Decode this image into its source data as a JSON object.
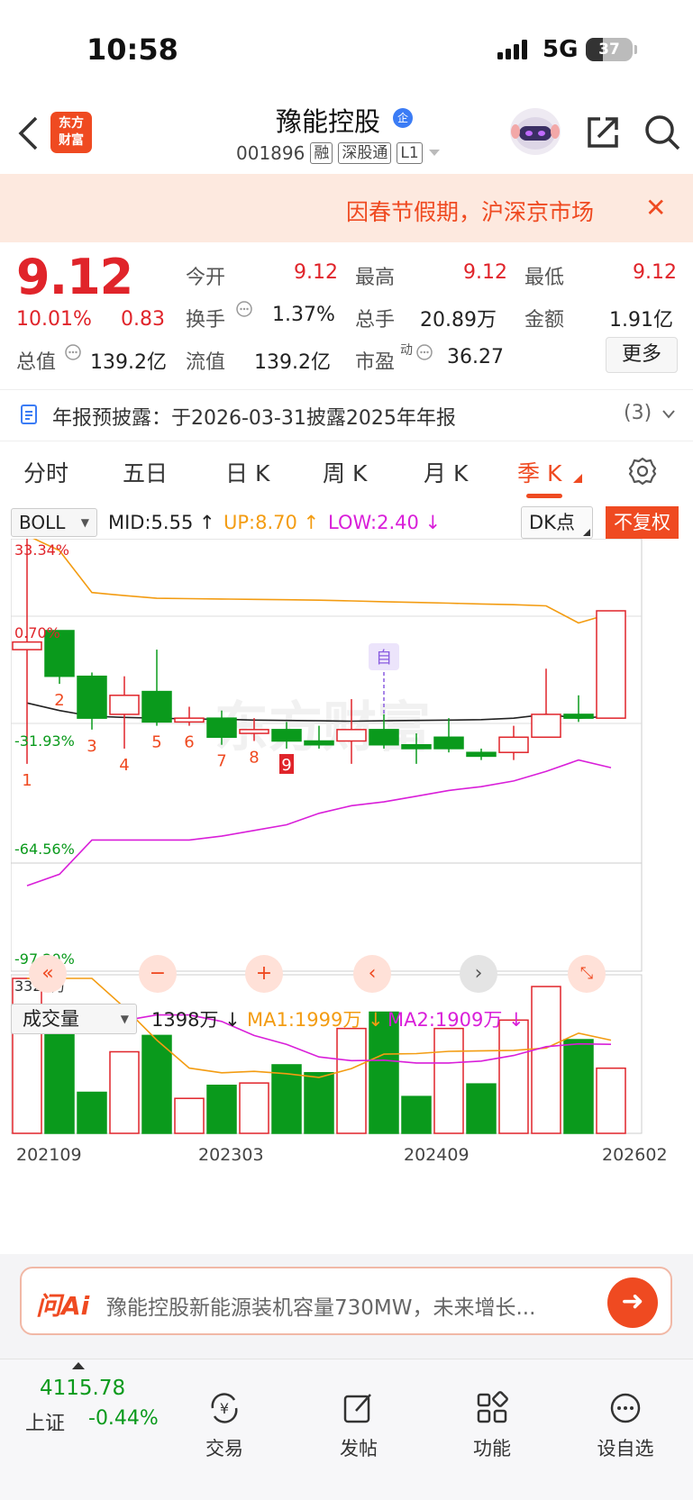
{
  "status_bar": {
    "time": "10:58",
    "network": "5G",
    "battery": "37"
  },
  "header": {
    "logo_line1": "东方",
    "logo_line2": "财富",
    "stock_name": "豫能控股",
    "badge": "企",
    "code": "001896",
    "tags": [
      "融",
      "深股通",
      "L1"
    ]
  },
  "banner": {
    "text": "因春节假期，沪深京市场"
  },
  "quote": {
    "price": "9.12",
    "change_pct": "10.01%",
    "change": "0.83",
    "labels": {
      "open": "今开",
      "high": "最高",
      "low": "最低",
      "turnover": "换手",
      "volume": "总手",
      "amount": "金额",
      "total_value": "总值",
      "float_value": "流值",
      "pe": "市盈",
      "pe_sup": "动",
      "more": "更多"
    },
    "values": {
      "open": "9.12",
      "high": "9.12",
      "low": "9.12",
      "turnover": "1.37%",
      "volume": "20.89万",
      "amount": "1.91亿",
      "total_value": "139.2亿",
      "float_value": "139.2亿",
      "pe": "36.27"
    }
  },
  "notice": {
    "text": "年报预披露：于2026-03-31披露2025年年报",
    "count": "(3)"
  },
  "tabs": [
    "分时",
    "五日",
    "日 K",
    "周 K",
    "月 K",
    "季 K"
  ],
  "indicator": {
    "select": "BOLL",
    "mid": "MID:5.55",
    "up": "UP:8.70",
    "low": "LOW:2.40",
    "dk": "DK点",
    "fq": "不复权"
  },
  "chart_data": {
    "type": "candlestick",
    "period": "季K",
    "axis_labels": [
      "33.34%",
      "0.70%",
      "-31.93%",
      "-64.56%",
      "-97.20%"
    ],
    "marker": "自",
    "annotations": [
      "1",
      "2",
      "3",
      "4",
      "5",
      "6",
      "7",
      "8",
      "9"
    ],
    "candles": [
      {
        "open": 8.1,
        "close": 8.3,
        "high": 11.2,
        "low": 5.1
      },
      {
        "open": 8.6,
        "close": 7.4,
        "high": 8.6,
        "low": 7.2
      },
      {
        "open": 7.4,
        "close": 6.3,
        "high": 7.5,
        "low": 6.0
      },
      {
        "open": 6.4,
        "close": 6.9,
        "high": 7.4,
        "low": 5.5
      },
      {
        "open": 7.0,
        "close": 6.2,
        "high": 8.1,
        "low": 6.1
      },
      {
        "open": 6.2,
        "close": 6.3,
        "high": 6.6,
        "low": 6.1
      },
      {
        "open": 6.3,
        "close": 5.8,
        "high": 6.5,
        "low": 5.6
      },
      {
        "open": 5.9,
        "close": 6.0,
        "high": 6.3,
        "low": 5.7
      },
      {
        "open": 6.0,
        "close": 5.7,
        "high": 6.2,
        "low": 5.5
      },
      {
        "open": 5.7,
        "close": 5.6,
        "high": 6.1,
        "low": 5.5
      },
      {
        "open": 5.7,
        "close": 6.0,
        "high": 6.8,
        "low": 5.1
      },
      {
        "open": 6.0,
        "close": 5.6,
        "high": 6.4,
        "low": 5.5
      },
      {
        "open": 5.6,
        "close": 5.5,
        "high": 5.9,
        "low": 5.1
      },
      {
        "open": 5.8,
        "close": 5.5,
        "high": 6.3,
        "low": 5.4
      },
      {
        "open": 5.4,
        "close": 5.3,
        "high": 5.5,
        "low": 5.2
      },
      {
        "open": 5.4,
        "close": 5.8,
        "high": 6.1,
        "low": 5.2
      },
      {
        "open": 5.8,
        "close": 6.4,
        "high": 7.6,
        "low": 5.8
      },
      {
        "open": 6.4,
        "close": 6.3,
        "high": 6.9,
        "low": 6.2
      },
      {
        "open": 6.3,
        "close": 9.12,
        "high": 9.12,
        "low": 6.3
      }
    ],
    "boll_mid": [
      6.7,
      6.5,
      6.35,
      6.32,
      6.3,
      6.28,
      6.27,
      6.25,
      6.24,
      6.23,
      6.22,
      6.23,
      6.24,
      6.25,
      6.26,
      6.3,
      6.4,
      6.3,
      6.35
    ],
    "boll_up": [
      11.1,
      10.7,
      9.6,
      9.52,
      9.45,
      9.44,
      9.43,
      9.42,
      9.41,
      9.4,
      9.38,
      9.36,
      9.34,
      9.32,
      9.3,
      9.28,
      9.25,
      8.8,
      9.05
    ],
    "boll_low": [
      1.9,
      2.2,
      3.1,
      3.1,
      3.1,
      3.1,
      3.2,
      3.35,
      3.5,
      3.8,
      4.0,
      4.1,
      4.25,
      4.4,
      4.5,
      4.65,
      4.9,
      5.2,
      5.0
    ],
    "volume_label": "3325万",
    "volume": [
      3325,
      2470,
      880,
      1750,
      2100,
      750,
      1030,
      1080,
      1470,
      1300,
      2250,
      2600,
      790,
      2250,
      1060,
      2430,
      3150,
      2010,
      1398
    ],
    "volume_up": [
      true,
      false,
      false,
      true,
      false,
      true,
      false,
      true,
      false,
      false,
      true,
      false,
      false,
      true,
      false,
      true,
      true,
      false,
      true
    ],
    "vol_ma1": [
      3325,
      3325,
      3325,
      2700,
      2000,
      1400,
      1300,
      1330,
      1280,
      1200,
      1390,
      1700,
      1710,
      1760,
      1770,
      1780,
      1830,
      2150,
      1999
    ],
    "vol_ma2": [
      2270,
      2290,
      2300,
      2420,
      2540,
      2540,
      2400,
      2100,
      1910,
      1640,
      1560,
      1570,
      1510,
      1510,
      1550,
      1670,
      1860,
      1920,
      1909
    ],
    "x_labels": [
      "202109",
      "202303",
      "202409",
      "202602"
    ]
  },
  "volume": {
    "select": "成交量",
    "current": "1398万",
    "ma1": "MA1:1999万",
    "ma2": "MA2:1909万"
  },
  "ai_bar": {
    "logo": "问Ai",
    "text": "豫能控股新能源装机容量730MW，未来增长..."
  },
  "bottom_nav": {
    "index_value": "4115.78",
    "index_name": "上证",
    "index_change": "-0.44%",
    "items": [
      "交易",
      "发帖",
      "功能",
      "设自选"
    ]
  },
  "colors": {
    "up": "#e0242a",
    "down": "#0a9a1c",
    "accent": "#ef4a21",
    "boll_up": "#f39c12",
    "boll_low": "#d91fd9"
  }
}
